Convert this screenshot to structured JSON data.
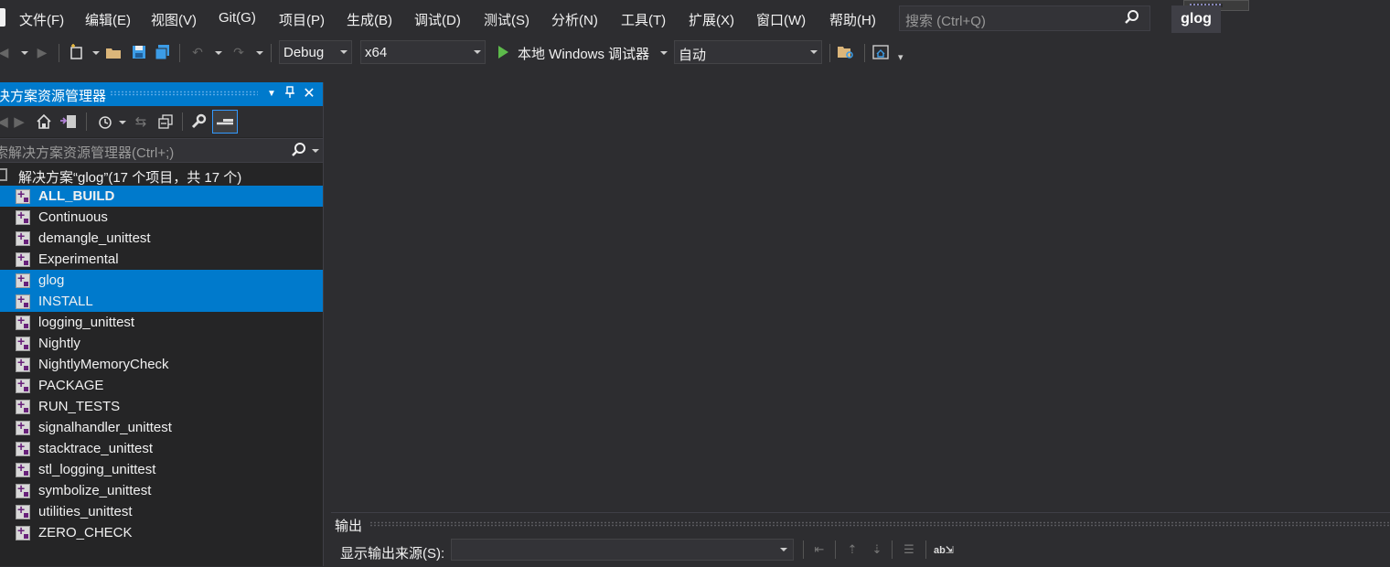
{
  "menu": {
    "items": [
      "文件(F)",
      "编辑(E)",
      "视图(V)",
      "Git(G)",
      "项目(P)",
      "生成(B)",
      "调试(D)",
      "测试(S)",
      "分析(N)",
      "工具(T)",
      "扩展(X)",
      "窗口(W)",
      "帮助(H)"
    ],
    "search_placeholder": "搜索 (Ctrl+Q)",
    "project_badge": "glog"
  },
  "toolbar": {
    "config": "Debug",
    "platform": "x64",
    "run_target": "本地 Windows 调试器",
    "run_mode": "自动",
    "accent_run": "#5dba4b"
  },
  "solution_explorer": {
    "title": "决方案资源管理器",
    "search_placeholder": "索解决方案资源管理器(Ctrl+;)",
    "root_label": "解决方案“glog”(17 个项目，共 17 个)",
    "projects": [
      {
        "name": "ALL_BUILD",
        "selected": true,
        "bold": true
      },
      {
        "name": "Continuous",
        "selected": false,
        "bold": false
      },
      {
        "name": "demangle_unittest",
        "selected": false,
        "bold": false
      },
      {
        "name": "Experimental",
        "selected": false,
        "bold": false
      },
      {
        "name": "glog",
        "selected": true,
        "bold": false
      },
      {
        "name": "INSTALL",
        "selected": true,
        "bold": false
      },
      {
        "name": "logging_unittest",
        "selected": false,
        "bold": false
      },
      {
        "name": "Nightly",
        "selected": false,
        "bold": false
      },
      {
        "name": "NightlyMemoryCheck",
        "selected": false,
        "bold": false
      },
      {
        "name": "PACKAGE",
        "selected": false,
        "bold": false
      },
      {
        "name": "RUN_TESTS",
        "selected": false,
        "bold": false
      },
      {
        "name": "signalhandler_unittest",
        "selected": false,
        "bold": false
      },
      {
        "name": "stacktrace_unittest",
        "selected": false,
        "bold": false
      },
      {
        "name": "stl_logging_unittest",
        "selected": false,
        "bold": false
      },
      {
        "name": "symbolize_unittest",
        "selected": false,
        "bold": false
      },
      {
        "name": "utilities_unittest",
        "selected": false,
        "bold": false
      },
      {
        "name": "ZERO_CHECK",
        "selected": false,
        "bold": false
      }
    ],
    "accent": "#007acc"
  },
  "output": {
    "title": "输出",
    "source_label": "显示输出来源(S):",
    "source_value": ""
  }
}
